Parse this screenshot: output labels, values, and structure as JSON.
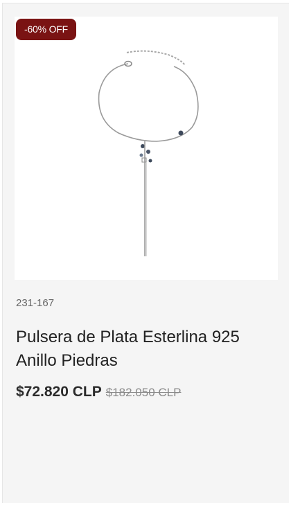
{
  "product": {
    "badge": "-60% OFF",
    "sku": "231-167",
    "title": "Pulsera de Plata Esterlina 925 Anillo Piedras",
    "price_current": "$72.820 CLP",
    "price_old": "$182.050 CLP"
  },
  "colors": {
    "badge_bg": "#7a1313",
    "card_bg": "#f5f5f5",
    "chain": "#9a9a9a",
    "stone": "#3e4a5c"
  },
  "icons": {
    "product_image": "silver-bracelet-with-dangling-chain"
  }
}
